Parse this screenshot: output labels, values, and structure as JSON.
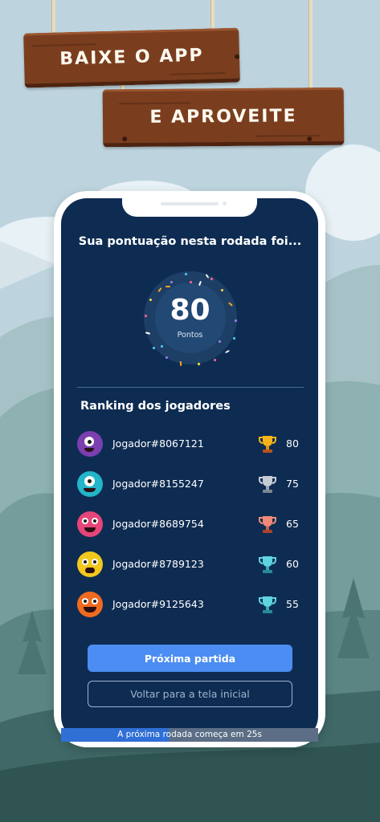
{
  "banner": {
    "line1": "BAIXE O APP",
    "line2": "E APROVEITE"
  },
  "round": {
    "heading": "Sua pontuação nesta rodada foi...",
    "score": "80",
    "score_unit": "Pontos"
  },
  "ranking": {
    "title": "Ranking dos jogadores",
    "players": [
      {
        "name": "Jogador#8067121",
        "points": "80",
        "avatar": "purple-monster-icon",
        "trophy": "gold-trophy-icon",
        "color": "#7b3fb0"
      },
      {
        "name": "Jogador#8155247",
        "points": "75",
        "avatar": "cyan-monster-icon",
        "trophy": "silver-trophy-icon",
        "color": "#23b5c9"
      },
      {
        "name": "Jogador#8689754",
        "points": "65",
        "avatar": "pink-monster-icon",
        "trophy": "bronze-trophy-icon",
        "color": "#e6457a"
      },
      {
        "name": "Jogador#8789123",
        "points": "60",
        "avatar": "yellow-monster-icon",
        "trophy": "teal-trophy-icon",
        "color": "#f2c81d"
      },
      {
        "name": "Jogador#9125643",
        "points": "55",
        "avatar": "orange-monster-icon",
        "trophy": "teal-trophy-icon",
        "color": "#f06a1f"
      }
    ]
  },
  "actions": {
    "next_match": "Próxima partida",
    "back_home": "Voltar para a tela inicial"
  },
  "countdown": {
    "text": "A próxima rodada começa em 25s",
    "progress": 0.42
  },
  "colors": {
    "screen_bg": "#0e2c52",
    "primary": "#4b8df2",
    "wood": "#7a3e1f"
  }
}
